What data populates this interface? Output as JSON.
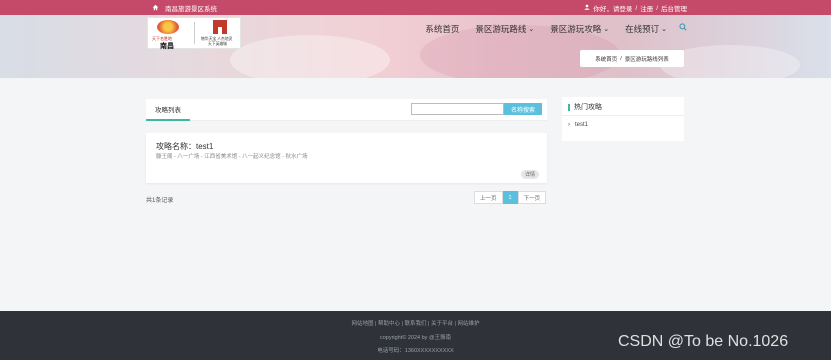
{
  "topbar": {
    "site_name": "南昌旅游景区系统",
    "auth_prompt": "你好，请登录",
    "register": "注册",
    "admin": "后台管理"
  },
  "logo": {
    "left_text": "天下名胜地",
    "left_city": "南昌",
    "right_line1": "物华天宝 人杰地灵",
    "right_line2": "天下英雄城"
  },
  "nav": {
    "items": [
      {
        "label": "系统首页",
        "dropdown": false
      },
      {
        "label": "景区游玩路线",
        "dropdown": true
      },
      {
        "label": "景区游玩攻略",
        "dropdown": true
      },
      {
        "label": "在线预订",
        "dropdown": true
      }
    ]
  },
  "breadcrumb": {
    "home": "系统首页",
    "separator": "/",
    "current": "景区游玩路线列表"
  },
  "main": {
    "tab_label": "攻略列表",
    "search_placeholder": "",
    "search_button": "名称搜索"
  },
  "result": {
    "title": "攻略名称：test1",
    "route": "滕王阁 - 八一广场 - 江西省美术馆 - 八一起义纪念馆 - 秋水广场",
    "detail_button": "详情"
  },
  "pagination": {
    "total": "共1条记录",
    "prev": "上一页",
    "current": "1",
    "next": "下一页"
  },
  "sidebar": {
    "title": "热门攻略",
    "items": [
      {
        "label": "test1"
      }
    ]
  },
  "footer": {
    "links": [
      "网站地图",
      "帮助中心",
      "联系我们",
      "关于平台",
      "网站维护"
    ],
    "link_separator": "|",
    "copyright": "copyright© 2024 by @王振南",
    "phone": "电话号码：1360XXXXXXXXXX"
  },
  "watermark": "CSDN @To be No.1026",
  "colors": {
    "topbar": "#c54a6a",
    "accent": "#5bc0de",
    "tab_underline": "#3fb8a0",
    "footer": "#2f3238"
  },
  "icons": {
    "home": "home-icon",
    "login": "user-icon",
    "search": "search-icon",
    "chevron": "chevron-down-icon",
    "list_bullet": "chevron-right-icon"
  }
}
